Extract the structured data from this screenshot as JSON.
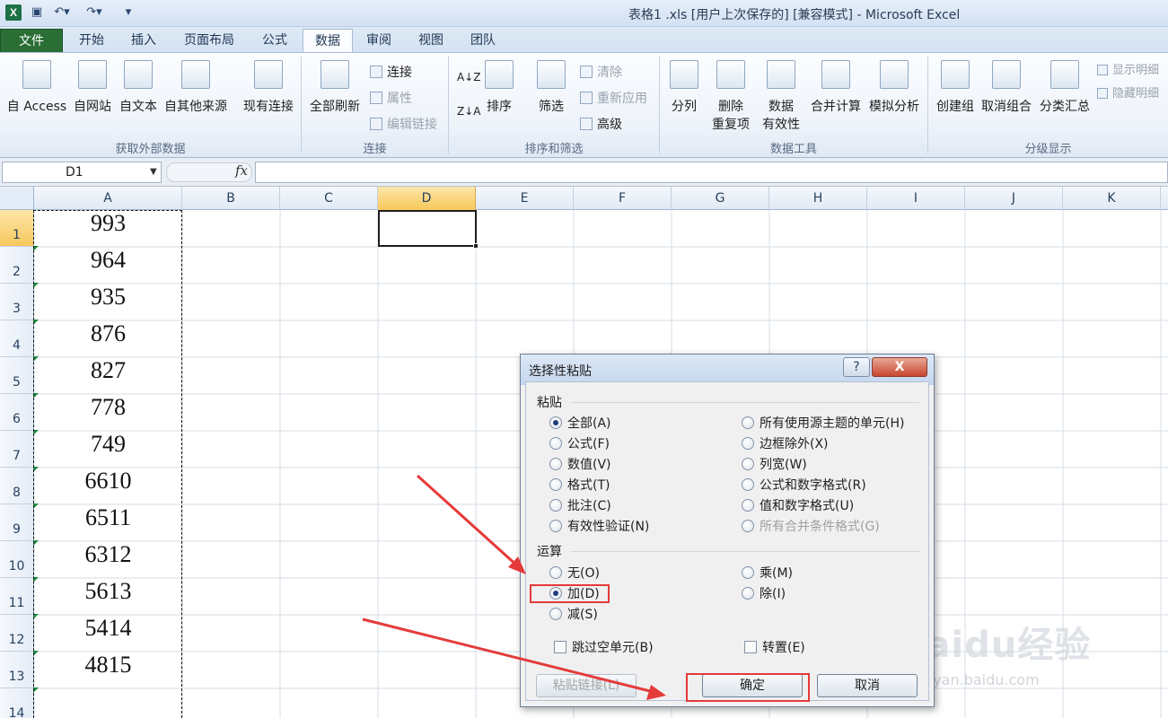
{
  "window": {
    "title": "表格1 .xls [用户上次保存的] [兼容模式] - Microsoft Excel",
    "app_icon": "X"
  },
  "quick_access": {
    "save": "save-icon",
    "undo": "undo-icon",
    "redo": "redo-icon"
  },
  "tabs": [
    "文件",
    "开始",
    "插入",
    "页面布局",
    "公式",
    "数据",
    "审阅",
    "视图",
    "团队"
  ],
  "active_tab": "数据",
  "ribbon": {
    "groups": {
      "external": "获取外部数据",
      "connections": "连接",
      "sort_filter": "排序和筛选",
      "data_tools": "数据工具",
      "outline": "分级显示"
    },
    "buttons": {
      "access": "自 Access",
      "web": "自网站",
      "text": "自文本",
      "other": "自其他来源",
      "existing": "现有连接",
      "refresh_all": "全部刷新",
      "connections": "连接",
      "properties": "属性",
      "edit_links": "编辑链接",
      "sort": "排序",
      "filter": "筛选",
      "clear": "清除",
      "reapply": "重新应用",
      "advanced": "高级",
      "split": "分列",
      "remove_dup_1": "删除",
      "remove_dup_2": "重复项",
      "validation_1": "数据",
      "validation_2": "有效性",
      "consolidate": "合并计算",
      "what_if": "模拟分析",
      "group": "创建组",
      "ungroup": "取消组合",
      "subtotal": "分类汇总",
      "show_detail": "显示明细",
      "hide_detail": "隐藏明细"
    }
  },
  "formula_bar": {
    "name_box": "D1",
    "fx": "fx",
    "value": ""
  },
  "sheet": {
    "columns": [
      "A",
      "B",
      "C",
      "D",
      "E",
      "F",
      "G",
      "H",
      "I",
      "J",
      "K"
    ],
    "selected_column": "D",
    "rows": [
      "1",
      "2",
      "3",
      "4",
      "5",
      "6",
      "7",
      "8",
      "9",
      "10",
      "11",
      "12",
      "13",
      "14"
    ],
    "selected_row": "1",
    "column_a_values": [
      "993",
      "964",
      "935",
      "876",
      "827",
      "778",
      "749",
      "6610",
      "6511",
      "6312",
      "5613",
      "5414",
      "4815"
    ]
  },
  "dialog": {
    "title": "选择性粘贴",
    "help": "?",
    "close": "X",
    "paste_section": "粘贴",
    "paste_options_left": [
      "全部(A)",
      "公式(F)",
      "数值(V)",
      "格式(T)",
      "批注(C)",
      "有效性验证(N)"
    ],
    "paste_options_right": [
      "所有使用源主题的单元(H)",
      "边框除外(X)",
      "列宽(W)",
      "公式和数字格式(R)",
      "值和数字格式(U)",
      "所有合并条件格式(G)"
    ],
    "paste_selected": "全部(A)",
    "operation_section": "运算",
    "operation_left": [
      "无(O)",
      "加(D)",
      "减(S)"
    ],
    "operation_right": [
      "乘(M)",
      "除(I)"
    ],
    "operation_selected": "加(D)",
    "skip_blanks": "跳过空单元(B)",
    "transpose": "转置(E)",
    "paste_link": "粘贴链接(L)",
    "ok": "确定",
    "cancel": "取消"
  },
  "watermark": {
    "brand": "Baidu经验",
    "url": "jingyan.baidu.com"
  },
  "colors": {
    "annotation_red": "#e53a3a",
    "file_tab": "#2a6e35",
    "selected_header": "#f7c85b"
  }
}
